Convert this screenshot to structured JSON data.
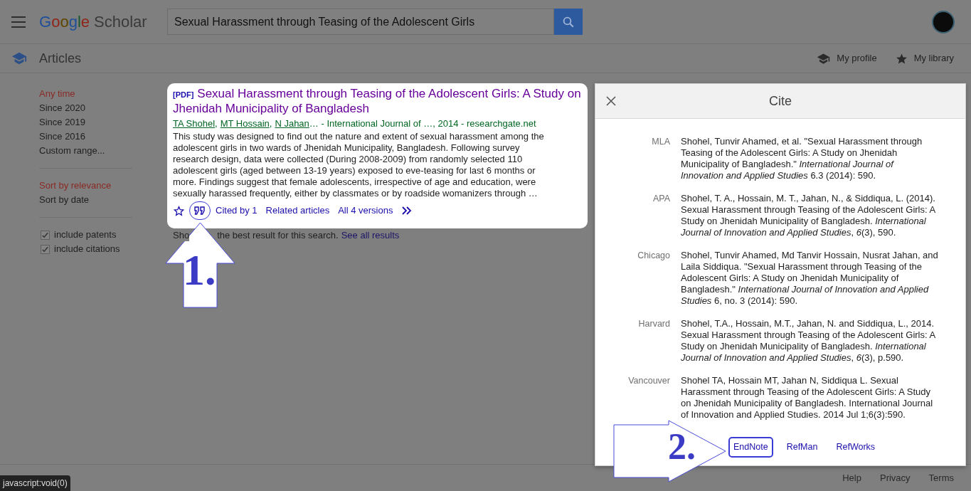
{
  "header": {
    "logo": {
      "first": "Google",
      "second": "Scholar"
    },
    "search": {
      "value": "Sexual Harassment through Teasing of the Adolescent Girls"
    }
  },
  "subheader": {
    "title": "Articles",
    "links": [
      {
        "kind": "profile",
        "label": "My profile"
      },
      {
        "kind": "library",
        "label": "My library"
      }
    ]
  },
  "sidebar": {
    "time_filters": [
      {
        "label": "Any time",
        "selected": true
      },
      {
        "label": "Since 2020",
        "selected": false
      },
      {
        "label": "Since 2019",
        "selected": false
      },
      {
        "label": "Since 2016",
        "selected": false
      },
      {
        "label": "Custom range...",
        "selected": false
      }
    ],
    "sort": [
      {
        "label": "Sort by relevance",
        "selected": true
      },
      {
        "label": "Sort by date",
        "selected": false
      }
    ],
    "options": [
      {
        "label": "include patents",
        "checked": true
      },
      {
        "label": "include citations",
        "checked": true
      }
    ]
  },
  "result": {
    "format": "[PDF]",
    "title": "Sexual Harassment through Teasing of the Adolescent Girls: A Study on Jhenidah Municipality of Bangladesh",
    "authors": [
      "TA Shohel",
      "MT Hossain",
      "N Jahan"
    ],
    "author_separator": ",",
    "authors_more": "…",
    "source": "- International Journal of …, 2014 - researchgate.net",
    "snippet": "This study was designed to find out the nature and extent of sexual harassment among the adolescent girls in two wards of Jhenidah Municipality, Bangladesh. Following survey research design, data were collected (During 2008-2009) from randomly selected 110 adolescent girls (aged between 13-19 years) exposed to eve-teasing for last 6 months or more. Findings suggest that female adolescents, irrespective of age and education, were sexually harassed frequently, either by classmates or by roadside womanizers through …",
    "cite_highlighted": true,
    "actions": [
      "Cited by 1",
      "Related articles",
      "All 4 versions"
    ]
  },
  "notice": {
    "lead": "Sho",
    "rest": "the best result for this search.",
    "link": "See all results"
  },
  "cite_dialog": {
    "title": "Cite",
    "citations": [
      {
        "style": "MLA",
        "text": "Shohel, Tunvir Ahamed, et al. \"Sexual Harassment through Teasing of the Adolescent Girls: A Study on Jhenidah Municipality of Bangladesh.\" *International Journal of Innovation and Applied Studies* 6.3 (2014): 590."
      },
      {
        "style": "APA",
        "text": "Shohel, T. A., Hossain, M. T., Jahan, N., & Siddiqua, L. (2014). Sexual Harassment through Teasing of the Adolescent Girls: A Study on Jhenidah Municipality of Bangladesh. *International Journal of Innovation and Applied Studies*, *6*(3), 590."
      },
      {
        "style": "Chicago",
        "text": "Shohel, Tunvir Ahamed, Md Tanvir Hossain, Nusrat Jahan, and Laila Siddiqua. \"Sexual Harassment through Teasing of the Adolescent Girls: A Study on Jhenidah Municipality of Bangladesh.\" *International Journal of Innovation and Applied Studies* 6, no. 3 (2014): 590."
      },
      {
        "style": "Harvard",
        "text": "Shohel, T.A., Hossain, M.T., Jahan, N. and Siddiqua, L., 2014. Sexual Harassment through Teasing of the Adolescent Girls: A Study on Jhenidah Municipality of Bangladesh. *International Journal of Innovation and Applied Studies*, *6*(3), p.590."
      },
      {
        "style": "Vancouver",
        "text": "Shohel TA, Hossain MT, Jahan N, Siddiqua L. Sexual Harassment through Teasing of the Adolescent Girls: A Study on Jhenidah Municipality of Bangladesh. International Journal of Innovation and Applied Studies. 2014 Jul 1;6(3):590."
      }
    ],
    "exports": [
      {
        "label": "EndNote",
        "highlighted": true
      },
      {
        "label": "RefMan",
        "highlighted": false
      },
      {
        "label": "RefWorks",
        "highlighted": false
      }
    ]
  },
  "annotations": [
    {
      "label": "1."
    },
    {
      "label": "2."
    }
  ],
  "footer": [
    "Help",
    "Privacy",
    "Terms"
  ],
  "status_tooltip": "javascript:void(0)"
}
